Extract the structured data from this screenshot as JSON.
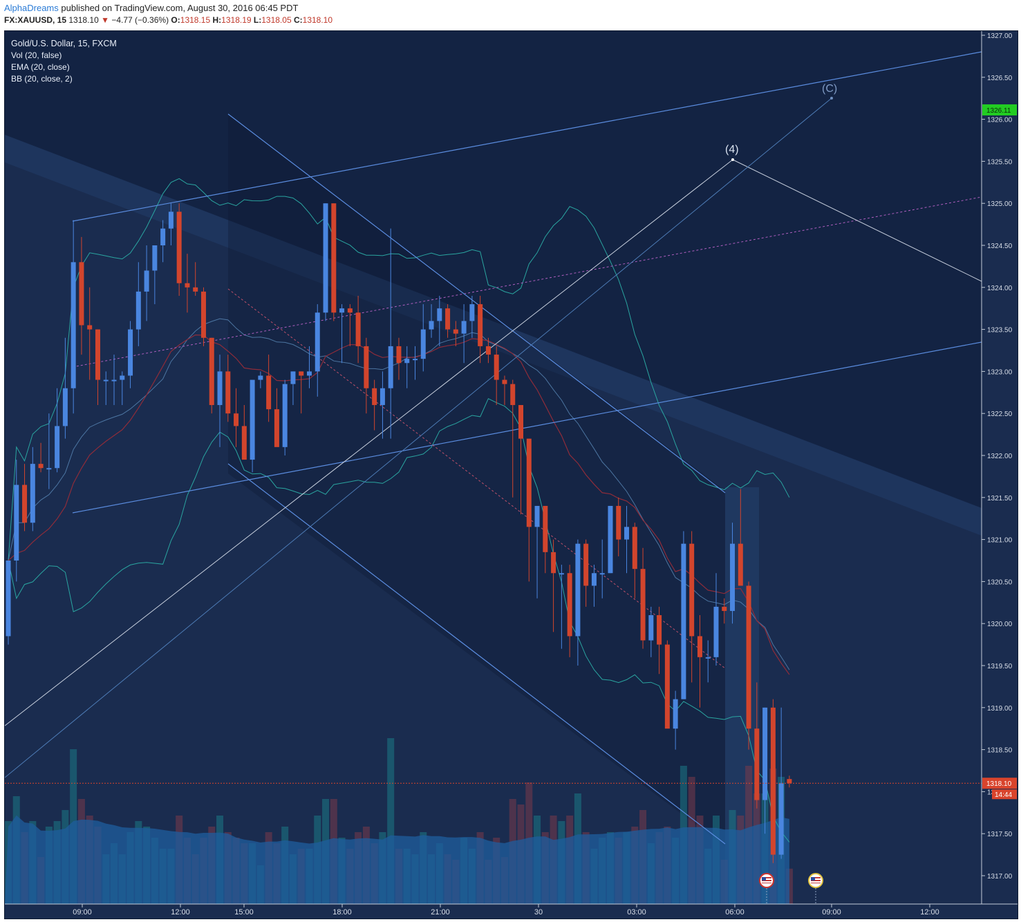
{
  "header": {
    "author": "AlphaDreams",
    "published": "published on TradingView.com, August 30, 2016 06:45 PDT",
    "symbol": "FX:XAUUSD, 15",
    "last": "1318.10",
    "change": "−4.77 (−0.36%)",
    "o_label": "O:",
    "o_value": "1318.15",
    "h_label": "H:",
    "h_value": "1318.19",
    "l_label": "L:",
    "l_value": "1318.05",
    "c_label": "C:",
    "c_value": "1318.10"
  },
  "legend": {
    "title": "Gold/U.S. Dollar, 15, FXCM",
    "vol": "Vol (20, false)",
    "ema": "EMA (20, close)",
    "bb": "BB (20, close, 2)"
  },
  "labels": {
    "wave4": "(4)",
    "waveC": "(C)"
  },
  "price_axis": {
    "ticks": [
      "1327.00",
      "1326.50",
      "1326.00",
      "1325.50",
      "1325.00",
      "1324.50",
      "1324.00",
      "1323.50",
      "1323.00",
      "1322.50",
      "1322.00",
      "1321.50",
      "1321.00",
      "1320.50",
      "1320.00",
      "1319.50",
      "1319.00",
      "1318.50",
      "1318.00",
      "1317.50",
      "1317.00"
    ],
    "last_price": "1318.10",
    "countdown": "14:44",
    "target_price": "1326.11"
  },
  "time_axis": {
    "ticks": [
      "09:00",
      "12:00",
      "15:00",
      "18:00",
      "21:00",
      "30",
      "03:00",
      "06:00",
      "09:00",
      "12:00"
    ]
  },
  "colors": {
    "background": "#1a2c4f",
    "bull": "#4a86e0",
    "bear": "#d2452d",
    "last_price": "#d9442c",
    "target": "#22cc22",
    "band": "#2aa5a0",
    "ema": "#8e2c3a",
    "trendline": "#5b8de0",
    "wave": "#c7cfdd"
  },
  "chart_data": {
    "type": "candlestick",
    "title": "Gold/U.S. Dollar, 15, FXCM",
    "interval": "15",
    "x_range": [
      "Aug 29 07:00",
      "Aug 30 13:00"
    ],
    "ylim": [
      1316.6,
      1327.0
    ],
    "columns": [
      "open",
      "high",
      "low",
      "close"
    ],
    "candles": [
      [
        1319.85,
        1320.75,
        1319.75,
        1320.75
      ],
      [
        1320.75,
        1321.95,
        1320.5,
        1321.65
      ],
      [
        1321.65,
        1321.9,
        1321.1,
        1321.2
      ],
      [
        1321.2,
        1322.1,
        1321.1,
        1321.9
      ],
      [
        1321.9,
        1322.15,
        1321.8,
        1321.85
      ],
      [
        1321.85,
        1322.5,
        1321.6,
        1321.85
      ],
      [
        1321.85,
        1322.8,
        1321.8,
        1322.35
      ],
      [
        1322.35,
        1323.4,
        1322.2,
        1322.8
      ],
      [
        1322.8,
        1324.8,
        1322.5,
        1324.3
      ],
      [
        1324.3,
        1324.6,
        1323.2,
        1323.55
      ],
      [
        1323.55,
        1324.0,
        1322.9,
        1323.5
      ],
      [
        1323.5,
        1323.5,
        1322.6,
        1322.9
      ],
      [
        1322.9,
        1323.0,
        1322.6,
        1322.9
      ],
      [
        1322.9,
        1323.2,
        1322.6,
        1322.9
      ],
      [
        1322.9,
        1323.0,
        1322.6,
        1322.95
      ],
      [
        1322.95,
        1323.6,
        1322.8,
        1323.5
      ],
      [
        1323.5,
        1324.3,
        1323.3,
        1323.95
      ],
      [
        1323.95,
        1324.5,
        1323.6,
        1324.2
      ],
      [
        1324.2,
        1324.5,
        1323.8,
        1324.5
      ],
      [
        1324.5,
        1324.8,
        1324.3,
        1324.7
      ],
      [
        1324.7,
        1325.0,
        1324.5,
        1324.9
      ],
      [
        1324.9,
        1325.0,
        1323.9,
        1324.05
      ],
      [
        1324.05,
        1324.4,
        1323.7,
        1324.0
      ],
      [
        1324.0,
        1324.3,
        1323.9,
        1323.95
      ],
      [
        1323.95,
        1324.0,
        1323.3,
        1323.4
      ],
      [
        1323.4,
        1323.4,
        1322.5,
        1322.6
      ],
      [
        1322.6,
        1323.2,
        1322.1,
        1323.0
      ],
      [
        1323.0,
        1323.2,
        1322.4,
        1322.5
      ],
      [
        1322.5,
        1322.8,
        1322.1,
        1322.35
      ],
      [
        1322.35,
        1322.6,
        1322.0,
        1321.95
      ],
      [
        1321.95,
        1322.4,
        1321.8,
        1322.9
      ],
      [
        1322.9,
        1323.0,
        1322.8,
        1322.95
      ],
      [
        1322.95,
        1323.2,
        1322.4,
        1322.55
      ],
      [
        1322.55,
        1322.8,
        1322.2,
        1322.1
      ],
      [
        1322.1,
        1322.9,
        1322.0,
        1322.85
      ],
      [
        1322.85,
        1323.0,
        1322.6,
        1323.0
      ],
      [
        1323.0,
        1323.0,
        1322.5,
        1322.95
      ],
      [
        1322.95,
        1323.3,
        1322.8,
        1323.0
      ],
      [
        1323.0,
        1323.8,
        1322.7,
        1323.7
      ],
      [
        1323.7,
        1325.0,
        1323.6,
        1325.0
      ],
      [
        1325.0,
        1325.0,
        1323.6,
        1323.7
      ],
      [
        1323.7,
        1323.8,
        1323.1,
        1323.75
      ],
      [
        1323.75,
        1323.8,
        1323.3,
        1323.7
      ],
      [
        1323.7,
        1323.9,
        1323.1,
        1323.3
      ],
      [
        1323.3,
        1323.4,
        1322.5,
        1322.8
      ],
      [
        1322.8,
        1322.9,
        1322.3,
        1322.6
      ],
      [
        1322.6,
        1323.0,
        1322.2,
        1322.8
      ],
      [
        1322.8,
        1324.7,
        1322.2,
        1323.3
      ],
      [
        1323.3,
        1323.4,
        1322.9,
        1323.1
      ],
      [
        1323.1,
        1323.3,
        1322.8,
        1323.15
      ],
      [
        1323.15,
        1323.3,
        1322.9,
        1323.15
      ],
      [
        1323.15,
        1323.8,
        1323.0,
        1323.5
      ],
      [
        1323.5,
        1323.8,
        1323.4,
        1323.6
      ],
      [
        1323.6,
        1323.9,
        1323.3,
        1323.75
      ],
      [
        1323.75,
        1323.8,
        1323.4,
        1323.5
      ],
      [
        1323.5,
        1323.6,
        1323.3,
        1323.45
      ],
      [
        1323.45,
        1323.8,
        1323.1,
        1323.6
      ],
      [
        1323.6,
        1323.9,
        1323.4,
        1323.8
      ],
      [
        1323.8,
        1323.9,
        1323.1,
        1323.3
      ],
      [
        1323.3,
        1323.4,
        1323.1,
        1323.2
      ],
      [
        1323.2,
        1323.3,
        1322.6,
        1322.9
      ],
      [
        1322.9,
        1322.95,
        1322.6,
        1322.85
      ],
      [
        1322.85,
        1322.9,
        1321.5,
        1322.6
      ],
      [
        1322.6,
        1322.6,
        1321.3,
        1322.2
      ],
      [
        1322.2,
        1322.2,
        1320.5,
        1321.15
      ],
      [
        1321.15,
        1321.4,
        1320.3,
        1321.4
      ],
      [
        1321.4,
        1321.4,
        1320.6,
        1320.85
      ],
      [
        1320.85,
        1321.0,
        1319.9,
        1320.6
      ],
      [
        1320.6,
        1320.7,
        1319.7,
        1320.6
      ],
      [
        1320.6,
        1320.7,
        1319.6,
        1319.85
      ],
      [
        1319.85,
        1321.0,
        1319.5,
        1320.95
      ],
      [
        1320.95,
        1321.0,
        1320.2,
        1320.45
      ],
      [
        1320.45,
        1320.7,
        1320.2,
        1320.6
      ],
      [
        1320.6,
        1321.0,
        1320.3,
        1320.6
      ],
      [
        1320.6,
        1321.4,
        1320.6,
        1321.4
      ],
      [
        1321.4,
        1321.5,
        1320.8,
        1321.0
      ],
      [
        1321.0,
        1321.4,
        1320.6,
        1321.15
      ],
      [
        1321.15,
        1321.2,
        1320.3,
        1320.65
      ],
      [
        1320.65,
        1320.9,
        1319.7,
        1319.8
      ],
      [
        1319.8,
        1320.2,
        1319.6,
        1320.1
      ],
      [
        1320.1,
        1320.2,
        1319.4,
        1319.75
      ],
      [
        1319.75,
        1319.8,
        1318.9,
        1318.75
      ],
      [
        1318.75,
        1319.2,
        1318.5,
        1319.1
      ],
      [
        1319.1,
        1321.1,
        1319.1,
        1320.95
      ],
      [
        1320.95,
        1321.1,
        1319.3,
        1319.85
      ],
      [
        1319.85,
        1320.1,
        1319.0,
        1319.6
      ],
      [
        1319.6,
        1319.8,
        1319.3,
        1319.6
      ],
      [
        1319.6,
        1320.6,
        1319.5,
        1320.2
      ],
      [
        1320.2,
        1320.3,
        1320.0,
        1320.15
      ],
      [
        1320.15,
        1321.2,
        1320.0,
        1320.95
      ],
      [
        1320.95,
        1321.6,
        1320.5,
        1320.45
      ],
      [
        1320.45,
        1320.5,
        1318.5,
        1318.75
      ],
      [
        1318.75,
        1319.3,
        1317.8,
        1317.9
      ],
      [
        1317.9,
        1319.0,
        1317.5,
        1319.0
      ],
      [
        1319.0,
        1319.1,
        1317.15,
        1317.25
      ],
      [
        1317.25,
        1319.0,
        1317.2,
        1318.1
      ],
      [
        1318.15,
        1318.19,
        1318.05,
        1318.1
      ]
    ]
  }
}
